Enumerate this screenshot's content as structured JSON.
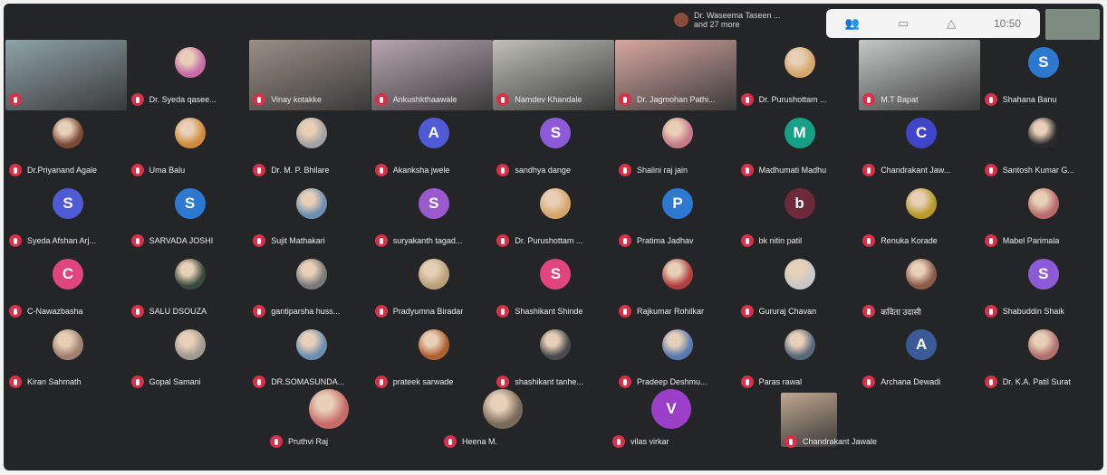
{
  "active_speaker": {
    "name": "Dr. Waseema Taseen ...",
    "more": "and 27 more"
  },
  "panel": {
    "time": "10:50",
    "icons": [
      "people-icon",
      "chat-icon",
      "hand-icon"
    ]
  },
  "colors": {
    "background": "#232527",
    "mic_off": "#d9304a"
  },
  "participants": [
    {
      "name": "",
      "avatar": "video",
      "color": "#8ea3a8"
    },
    {
      "name": "Dr. Syeda qasee...",
      "avatar": "photo",
      "color": "#c86aa6"
    },
    {
      "name": "Vinay kotakke",
      "avatar": "video",
      "color": "#9a8f86"
    },
    {
      "name": "Ankushkthaawale",
      "avatar": "video",
      "color": "#b8a6b0"
    },
    {
      "name": "Namdev Khandale",
      "avatar": "video",
      "color": "#c0c0b8"
    },
    {
      "name": "Dr. Jagmohan Pathi...",
      "avatar": "video",
      "color": "#d7a7a0"
    },
    {
      "name": "Dr. Purushottam ...",
      "avatar": "photo",
      "color": "#d6a66b"
    },
    {
      "name": "M.T Bapat",
      "avatar": "video",
      "color": "#c6c8c7"
    },
    {
      "name": "Shahana Banu",
      "avatar": "S",
      "color": "#2d79d2"
    },
    {
      "name": "Dr.Priyanand Agale",
      "avatar": "photo",
      "color": "#7b4b36"
    },
    {
      "name": "Uma Balu",
      "avatar": "photo",
      "color": "#d08b39"
    },
    {
      "name": "Dr. M. P. Bhilare",
      "avatar": "photo",
      "color": "#a2a2a2"
    },
    {
      "name": "Akanksha jwele",
      "avatar": "A",
      "color": "#4f5bd5"
    },
    {
      "name": "sandhya dange",
      "avatar": "S",
      "color": "#8e5bd8"
    },
    {
      "name": "Shalini raj jain",
      "avatar": "photo",
      "color": "#c87a8a"
    },
    {
      "name": "Madhumati Madhu",
      "avatar": "M",
      "color": "#16a085"
    },
    {
      "name": "Chandrakant Jaw...",
      "avatar": "C",
      "color": "#3f44c8"
    },
    {
      "name": "Santosh Kumar G...",
      "avatar": "photo",
      "color": "#2a2a2a"
    },
    {
      "name": "Syeda Afshan Arj...",
      "avatar": "S",
      "color": "#4f5bd5"
    },
    {
      "name": "SARVADA JOSHI",
      "avatar": "S",
      "color": "#2d79d2"
    },
    {
      "name": "Sujit Mathakari",
      "avatar": "photo",
      "color": "#6d8fb0"
    },
    {
      "name": "suryakanth tagad...",
      "avatar": "S",
      "color": "#9b59d0"
    },
    {
      "name": "Dr. Purushottam ...",
      "avatar": "photo",
      "color": "#d6a66b"
    },
    {
      "name": "Pratima Jadhav",
      "avatar": "P",
      "color": "#2d79d2"
    },
    {
      "name": "bk nitin patil",
      "avatar": "b",
      "color": "#6e2a3a"
    },
    {
      "name": "Renuka Korade",
      "avatar": "photo",
      "color": "#b79a2a"
    },
    {
      "name": "Mabel Parimala",
      "avatar": "photo",
      "color": "#b86a6a"
    },
    {
      "name": "C-Nawazbasha",
      "avatar": "C",
      "color": "#e0457b"
    },
    {
      "name": "SALU DSOUZA",
      "avatar": "photo",
      "color": "#3a4a3a"
    },
    {
      "name": "gantiparsha huss...",
      "avatar": "photo",
      "color": "#7a7a7a"
    },
    {
      "name": "Pradyumna Biradar",
      "avatar": "photo",
      "color": "#b9a07a"
    },
    {
      "name": "Shashikant Shinde",
      "avatar": "S",
      "color": "#e0457b"
    },
    {
      "name": "Rajkumar Rohilkar",
      "avatar": "photo",
      "color": "#b04040"
    },
    {
      "name": "Gururaj Chavan",
      "avatar": "photo",
      "color": "#c8c8c8"
    },
    {
      "name": "कविता उदासी",
      "avatar": "photo",
      "color": "#8a5a4a"
    },
    {
      "name": "Shabuddin Shaik",
      "avatar": "S",
      "color": "#8e5bd8"
    },
    {
      "name": "Kiran Sahmath",
      "avatar": "photo",
      "color": "#a08070"
    },
    {
      "name": "Gopal Samani",
      "avatar": "photo",
      "color": "#a09a90"
    },
    {
      "name": "DR.SOMASUNDA...",
      "avatar": "photo",
      "color": "#6d8fb0"
    },
    {
      "name": "prateek sarwade",
      "avatar": "photo",
      "color": "#b06030"
    },
    {
      "name": "shashikant tanhe...",
      "avatar": "photo",
      "color": "#4a4a4a"
    },
    {
      "name": "Pradeep Deshmu...",
      "avatar": "photo",
      "color": "#5a7ab0"
    },
    {
      "name": "Paras rawal",
      "avatar": "photo",
      "color": "#5a6a7a"
    },
    {
      "name": "Archana Dewadi",
      "avatar": "A",
      "color": "#3a5a9a"
    },
    {
      "name": "Dr. K.A. Patil Surat",
      "avatar": "photo",
      "color": "#b07070"
    },
    {
      "name": "Pruthvi Raj",
      "avatar": "photo",
      "color": "#c86a6a"
    },
    {
      "name": "Heena M.",
      "avatar": "photo",
      "color": "#7a6a5a"
    },
    {
      "name": "vilas virkar",
      "avatar": "V",
      "color": "#9b3fc8"
    },
    {
      "name": "Chandrakant Jawale",
      "avatar": "video",
      "color": "#c0a890"
    }
  ]
}
